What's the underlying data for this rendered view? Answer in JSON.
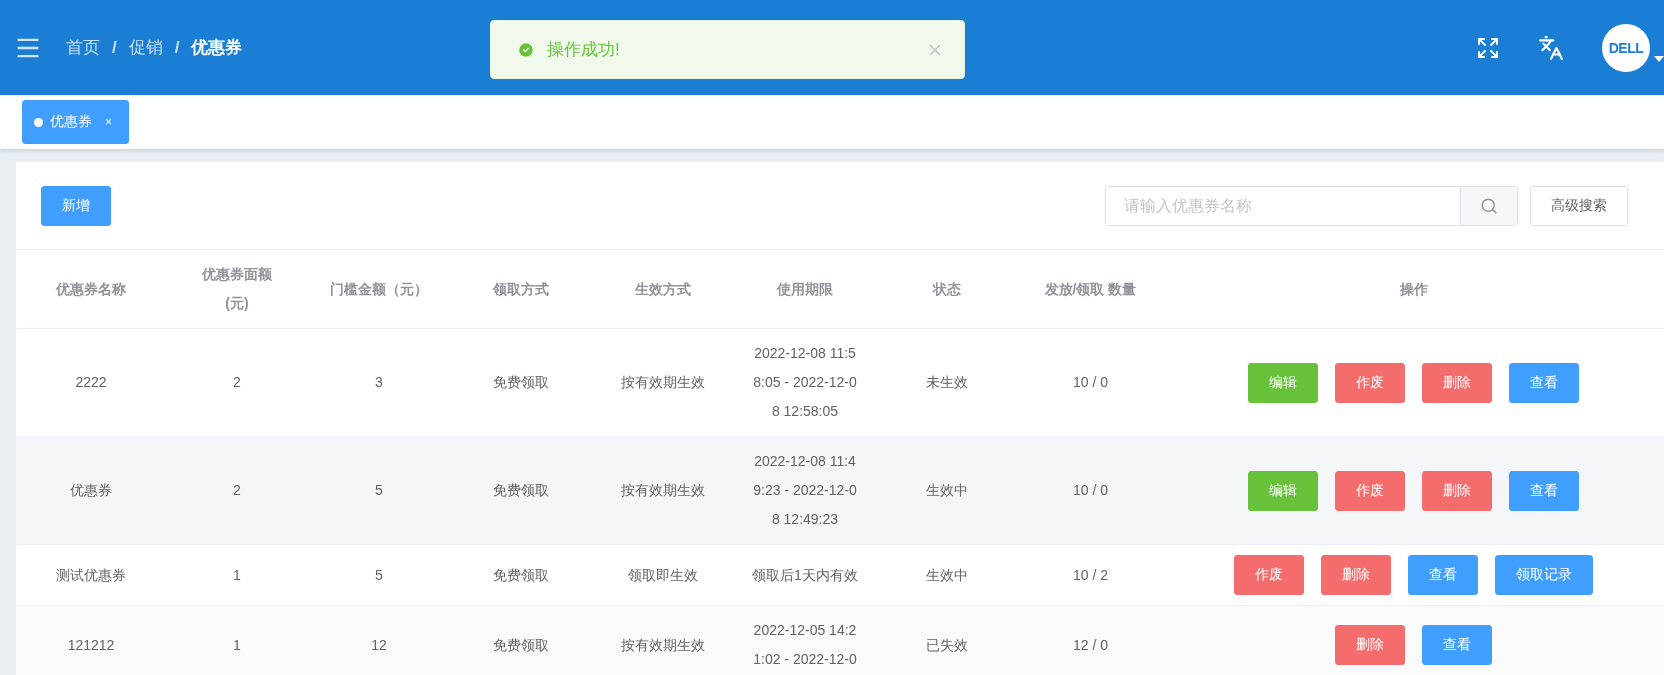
{
  "breadcrumb": [
    {
      "label": "首页",
      "current": false
    },
    {
      "label": "促销",
      "current": false
    },
    {
      "label": "优惠券",
      "current": true
    }
  ],
  "breadcrumb_separator": "/",
  "toast": {
    "kind": "success",
    "message": "操作成功!"
  },
  "avatar": {
    "logo_text": "DELL"
  },
  "tabs": [
    {
      "label": "优惠券",
      "selected": true,
      "close": "×"
    }
  ],
  "toolbar": {
    "add_button": "新增",
    "search": {
      "placeholder": "请输入优惠券名称"
    },
    "advanced_button": "高级搜索"
  },
  "table": {
    "columns": [
      "优惠券名称",
      "优惠券面额(元)",
      "门槛金额（元）",
      "领取方式",
      "生效方式",
      "使用期限",
      "状态",
      "发放/领取 数量",
      "操作"
    ],
    "rows": [
      {
        "cells": [
          "2222",
          "2",
          "3",
          "免费领取",
          "按有效期生效",
          "2022-12-08 11:58:05 - 2022-12-08 12:58:05",
          "未生效",
          "10 / 0"
        ],
        "actions": [
          {
            "label": "编辑",
            "kind": "edit"
          },
          {
            "label": "作废",
            "kind": "danger"
          },
          {
            "label": "删除",
            "kind": "danger"
          },
          {
            "label": "查看",
            "kind": "primary"
          }
        ]
      },
      {
        "cells": [
          "优惠券",
          "2",
          "5",
          "免费领取",
          "按有效期生效",
          "2022-12-08 11:49:23 - 2022-12-08 12:49:23",
          "生效中",
          "10 / 0"
        ],
        "actions": [
          {
            "label": "编辑",
            "kind": "edit"
          },
          {
            "label": "作废",
            "kind": "danger"
          },
          {
            "label": "删除",
            "kind": "danger"
          },
          {
            "label": "查看",
            "kind": "primary"
          }
        ]
      },
      {
        "cells": [
          "测试优惠券",
          "1",
          "5",
          "免费领取",
          "领取即生效",
          "领取后1天内有效",
          "生效中",
          "10 / 2"
        ],
        "actions": [
          {
            "label": "作废",
            "kind": "danger"
          },
          {
            "label": "删除",
            "kind": "danger"
          },
          {
            "label": "查看",
            "kind": "primary"
          },
          {
            "label": "领取记录",
            "kind": "primary"
          }
        ]
      },
      {
        "cells": [
          "121212",
          "1",
          "12",
          "免费领取",
          "按有效期生效",
          "2022-12-05 14:21:02 - 2022-12-0",
          "已失效",
          "12 / 0"
        ],
        "actions": [
          {
            "label": "删除",
            "kind": "danger"
          },
          {
            "label": "查看",
            "kind": "primary"
          }
        ]
      }
    ]
  }
}
